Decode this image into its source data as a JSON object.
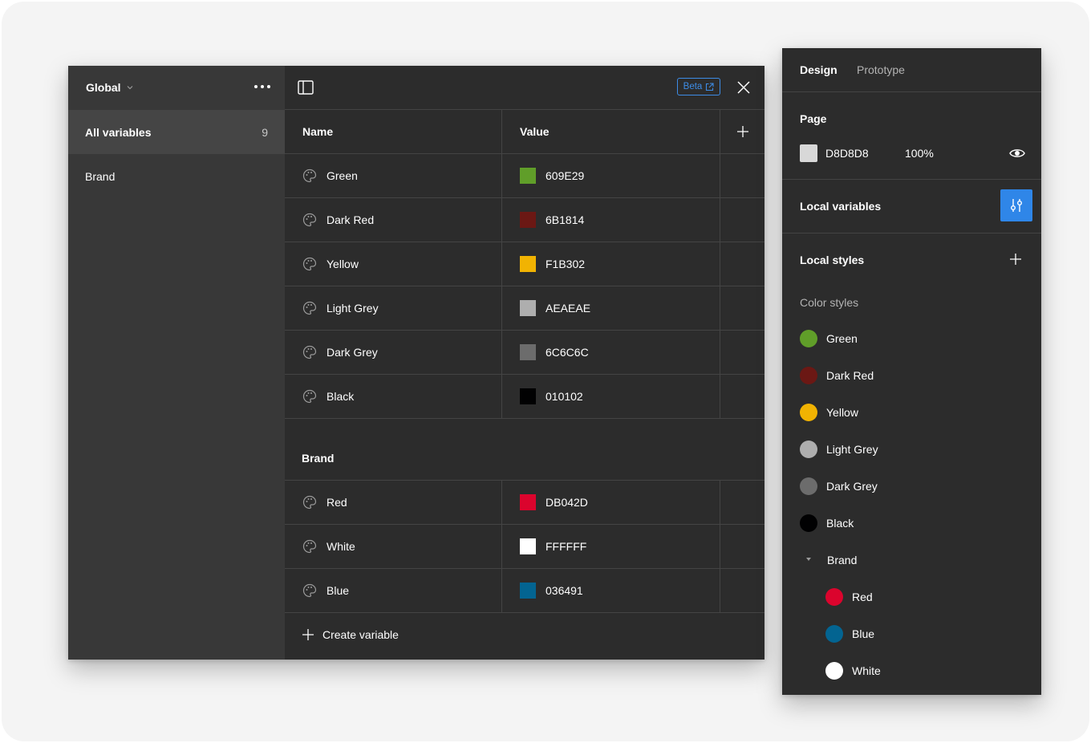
{
  "variables_modal": {
    "collection_name": "Global",
    "sidebar": {
      "items": [
        {
          "label": "All variables",
          "count": "9"
        },
        {
          "label": "Brand"
        }
      ]
    },
    "beta_label": "Beta",
    "columns": {
      "name": "Name",
      "value": "Value"
    },
    "ungrouped": [
      {
        "name": "Green",
        "value": "609E29",
        "color": "#609E29"
      },
      {
        "name": "Dark Red",
        "value": "6B1814",
        "color": "#6B1814"
      },
      {
        "name": "Yellow",
        "value": "F1B302",
        "color": "#F1B302"
      },
      {
        "name": "Light Grey",
        "value": "AEAEAE",
        "color": "#AEAEAE"
      },
      {
        "name": "Dark Grey",
        "value": "6C6C6C",
        "color": "#6C6C6C"
      },
      {
        "name": "Black",
        "value": "010102",
        "color": "#010102"
      }
    ],
    "group": {
      "title": "Brand",
      "items": [
        {
          "name": "Red",
          "value": "DB042D",
          "color": "#DB042D"
        },
        {
          "name": "White",
          "value": "FFFFFF",
          "color": "#FFFFFF"
        },
        {
          "name": "Blue",
          "value": "036491",
          "color": "#036491"
        }
      ]
    },
    "create_label": "Create variable",
    "icons": [
      "chevron-down-icon",
      "more-icon",
      "sidebar-toggle-icon",
      "external-link-icon",
      "close-icon",
      "plus-icon",
      "palette-icon"
    ]
  },
  "design_panel": {
    "tabs": [
      "Design",
      "Prototype"
    ],
    "page": {
      "title": "Page",
      "hex": "D8D8D8",
      "opacity": "100%",
      "color": "#D8D8D8"
    },
    "local_variables": {
      "title": "Local variables"
    },
    "local_styles": {
      "title": "Local styles",
      "color_styles_label": "Color styles",
      "styles": [
        {
          "name": "Green",
          "color": "#609E29"
        },
        {
          "name": "Dark Red",
          "color": "#6B1814"
        },
        {
          "name": "Yellow",
          "color": "#F1B302"
        },
        {
          "name": "Light Grey",
          "color": "#AEAEAE"
        },
        {
          "name": "Dark Grey",
          "color": "#6C6C6C"
        },
        {
          "name": "Black",
          "color": "#010102"
        }
      ],
      "group": {
        "name": "Brand",
        "styles": [
          {
            "name": "Red",
            "color": "#DB042D"
          },
          {
            "name": "Blue",
            "color": "#036491"
          },
          {
            "name": "White",
            "color": "#FFFFFF"
          }
        ]
      }
    },
    "accent_color": "#2F86E8"
  }
}
